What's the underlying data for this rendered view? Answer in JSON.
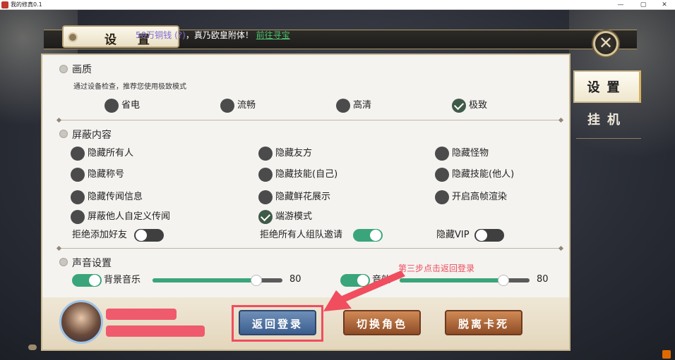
{
  "window": {
    "title": "我的修真0.1",
    "min": "—",
    "max": "▢",
    "close": "✕"
  },
  "header": {
    "title": "设 置",
    "marquee_prefix": "50万铜钱 ",
    "marquee_mid": "(?)",
    "marquee_suffix": "，真乃欧皇附体！",
    "marquee_link": "前往寻宝"
  },
  "close_button": "✕",
  "tabs": [
    {
      "label": "设置",
      "active": true
    },
    {
      "label": "挂机",
      "active": false
    }
  ],
  "quality": {
    "title": "画质",
    "note": "通过设备检查，推荐您使用极致模式",
    "options": [
      {
        "label": "省电",
        "selected": false
      },
      {
        "label": "流畅",
        "selected": false
      },
      {
        "label": "高清",
        "selected": false
      },
      {
        "label": "极致",
        "selected": true
      }
    ]
  },
  "block": {
    "title": "屏蔽内容",
    "options": [
      {
        "label": "隐藏所有人",
        "checked": false
      },
      {
        "label": "隐藏友方",
        "checked": false
      },
      {
        "label": "隐藏怪物",
        "checked": false
      },
      {
        "label": "隐藏称号",
        "checked": false
      },
      {
        "label": "隐藏技能(自己)",
        "checked": false
      },
      {
        "label": "隐藏技能(他人)",
        "checked": false
      },
      {
        "label": "隐藏传闻信息",
        "checked": false
      },
      {
        "label": "隐藏鲜花展示",
        "checked": false
      },
      {
        "label": "开启高帧渲染",
        "checked": false
      },
      {
        "label": "屏蔽他人自定义传闻",
        "checked": false
      },
      {
        "label": "端游模式",
        "checked": true
      }
    ],
    "toggles": [
      {
        "label": "拒绝添加好友",
        "on": false
      },
      {
        "label": "拒绝所有人组队邀请",
        "on": true
      },
      {
        "label": "隐藏VIP",
        "on": false
      }
    ]
  },
  "sound": {
    "title": "声音设置",
    "music": {
      "label": "背景音乐",
      "enabled": true,
      "value": 80
    },
    "effects": {
      "label": "音效",
      "enabled": true,
      "value": 80
    }
  },
  "buttons": {
    "back_login": "返回登录",
    "switch_role": "切换角色",
    "unstuck": "脱离卡死"
  },
  "annotation": "第三步点击返回登录",
  "colors": {
    "accent_green": "#3aa57a",
    "annotation_red": "#f04d5e"
  }
}
